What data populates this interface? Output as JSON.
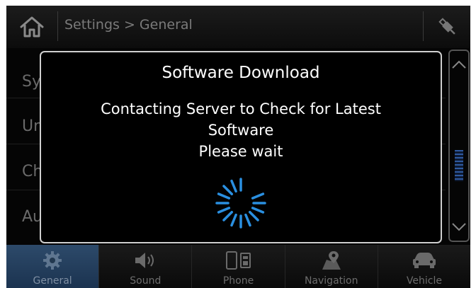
{
  "header": {
    "breadcrumb": "Settings > General",
    "icons": {
      "home": "home-icon",
      "usb": "usb-icon"
    }
  },
  "list": {
    "items": [
      "Sy",
      "Ur",
      "Ch",
      "Au"
    ]
  },
  "dialog": {
    "title": "Software Download",
    "message_line1": "Contacting Server to Check for Latest",
    "message_line2": "Software",
    "message_line3": "Please wait",
    "spinner_icon": "loading-spinner-icon"
  },
  "tabs": [
    {
      "label": "General",
      "icon": "gear-icon",
      "active": true
    },
    {
      "label": "Sound",
      "icon": "speaker-icon",
      "active": false
    },
    {
      "label": "Phone",
      "icon": "phone-icon",
      "active": false
    },
    {
      "label": "Navigation",
      "icon": "map-pin-icon",
      "active": false
    },
    {
      "label": "Vehicle",
      "icon": "car-icon",
      "active": false
    }
  ],
  "colors": {
    "accent_active_tab": "#2d4a6a",
    "spinner": "#2a8fe0",
    "dialog_border": "#cfcfcf"
  }
}
